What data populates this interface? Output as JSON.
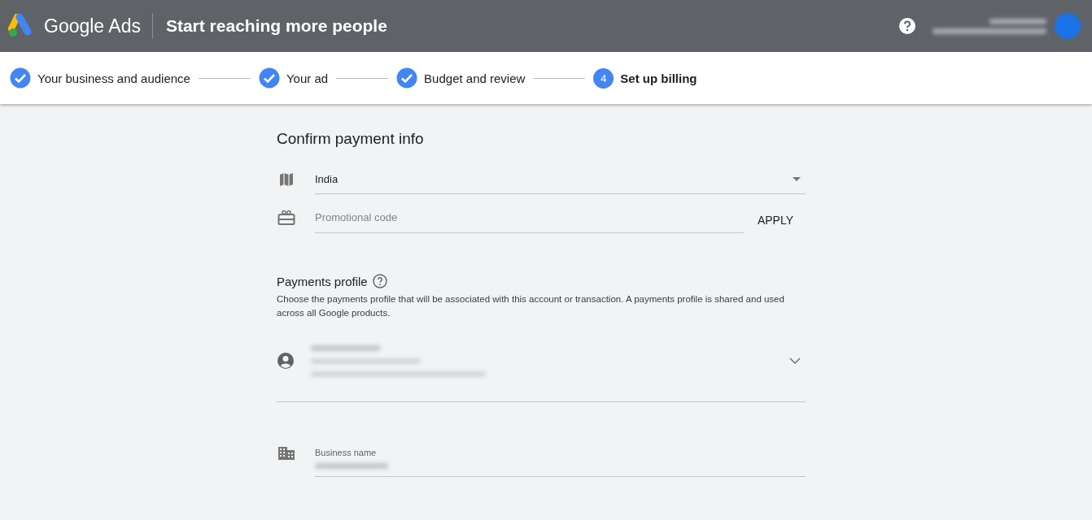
{
  "header": {
    "product": "Google Ads",
    "title": "Start reaching more people"
  },
  "steps": [
    {
      "label": "Your business and audience",
      "completed": true,
      "selected": false
    },
    {
      "label": "Your ad",
      "completed": true,
      "selected": false
    },
    {
      "label": "Budget and review",
      "completed": true,
      "selected": false
    },
    {
      "label": "Set up billing",
      "number": "4",
      "completed": false,
      "selected": true
    }
  ],
  "payment": {
    "title": "Confirm payment info",
    "country": {
      "value": "India"
    },
    "promo": {
      "placeholder": "Promotional code",
      "button": "APPLY"
    }
  },
  "profile": {
    "title": "Payments profile",
    "description": "Choose the payments profile that will be associated with this account or transaction. A payments profile is shared and used across all Google products.",
    "business_label": "Business name"
  }
}
